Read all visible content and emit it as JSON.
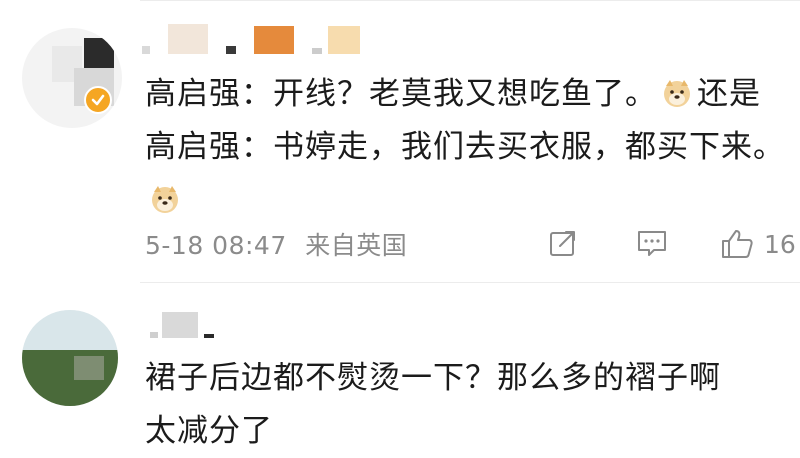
{
  "comment1": {
    "text_line_a": "高启强：开线？老莫我又想吃鱼了。",
    "text_line_b": "还是高启强：书婷走，我们去买衣服，都买下来。",
    "emoji": "doge-emoji",
    "timestamp": "5-18 08:47",
    "location": "来自英国",
    "like_count": "16",
    "badge_color": "#f5a623"
  },
  "comment2": {
    "text": "裙子后边都不熨烫一下？那么多的褶子啊",
    "text_cutoff": "太减分了"
  },
  "icons": {
    "share": "share-icon",
    "comment": "comment-icon",
    "like": "like-icon",
    "verified": "verified-badge-icon"
  }
}
